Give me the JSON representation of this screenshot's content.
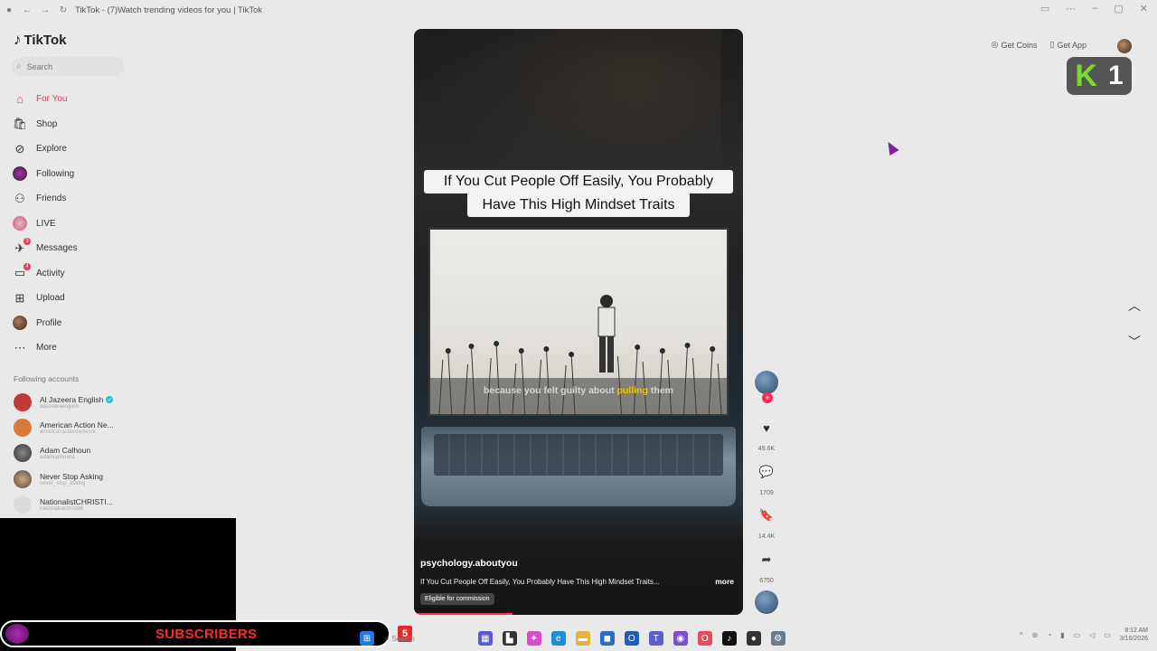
{
  "browser": {
    "tab_title": "TikTok - (7)Watch trending videos for you | TikTok"
  },
  "sidebar": {
    "logo": "TikTok",
    "search_placeholder": "Search",
    "items": [
      {
        "label": "For You",
        "icon": "home-icon",
        "active": true
      },
      {
        "label": "Shop",
        "icon": "shop-icon"
      },
      {
        "label": "Explore",
        "icon": "compass-icon"
      },
      {
        "label": "Following",
        "icon": "following-avatar-icon"
      },
      {
        "label": "Friends",
        "icon": "friends-icon"
      },
      {
        "label": "LIVE",
        "icon": "live-icon"
      },
      {
        "label": "Messages",
        "icon": "messages-icon",
        "badge": "3"
      },
      {
        "label": "Activity",
        "icon": "activity-icon",
        "badge": "4"
      },
      {
        "label": "Upload",
        "icon": "upload-icon"
      },
      {
        "label": "Profile",
        "icon": "profile-avatar-icon"
      },
      {
        "label": "More",
        "icon": "more-icon"
      }
    ],
    "following_title": "Following accounts",
    "accounts": [
      {
        "name": "Al Jazeera English",
        "handle": "aljazeeraenglish",
        "verified": true,
        "color": "#c23b3b"
      },
      {
        "name": "American Action Ne...",
        "handle": "americanactionnetwork",
        "color": "#d87a3a"
      },
      {
        "name": "Adam Calhoun",
        "handle": "adamcalhoun1",
        "color": "#555555"
      },
      {
        "name": "Never Stop Asking",
        "handle": "never_stop_asking",
        "color": "#8a7a6a"
      },
      {
        "name": "NationalistCHRISTI...",
        "handle": "nationalistchrist88",
        "color": "#dddddd"
      }
    ]
  },
  "video": {
    "caption_line1": "If You Cut People Off Easily, You Probably",
    "caption_line2": "Have This High Mindset Traits",
    "subtitle_pre": "because you felt guilty about ",
    "subtitle_hl": "pulling",
    "subtitle_post": " them",
    "author": "psychology.aboutyou",
    "description": "If You Cut People Off Easily, You Probably Have This High Mindset Traits...",
    "more": "more",
    "tag": "Eligible for commission",
    "progress": 0.3
  },
  "actions": {
    "likes": "49.6K",
    "comments": "1709",
    "saves": "14.4K",
    "shares": "6750"
  },
  "topbar": {
    "get_coins": "Get Coins",
    "get_app": "Get App"
  },
  "overlay": {
    "k_letter": "K",
    "k_number": "1",
    "subscribers": "SUBSCRIBERS",
    "subs_count": "5"
  },
  "taskbar": {
    "search": "Search",
    "time": "8:12 AM",
    "date": "3/16/2026"
  }
}
